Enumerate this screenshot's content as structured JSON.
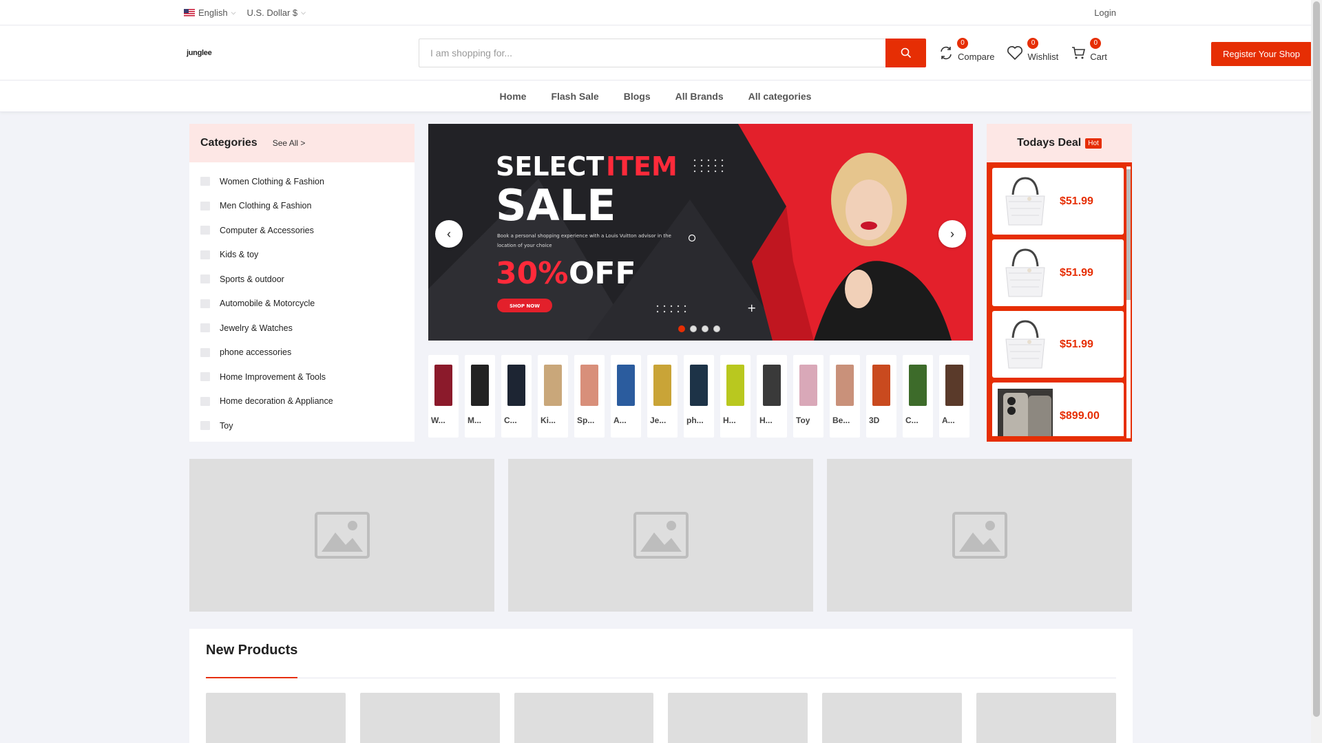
{
  "topbar": {
    "language": "English",
    "currency": "U.S. Dollar $",
    "login": "Login"
  },
  "header": {
    "logo_text": "junglee",
    "search_placeholder": "I am shopping for...",
    "compare": {
      "label": "Compare",
      "count": "0"
    },
    "wishlist": {
      "label": "Wishlist",
      "count": "0"
    },
    "cart": {
      "label": "Cart",
      "count": "0"
    },
    "register": "Register Your Shop"
  },
  "nav": [
    "Home",
    "Flash Sale",
    "Blogs",
    "All Brands",
    "All categories"
  ],
  "categories": {
    "title": "Categories",
    "see_all": "See All >",
    "items": [
      "Women Clothing & Fashion",
      "Men Clothing & Fashion",
      "Computer & Accessories",
      "Kids & toy",
      "Sports & outdoor",
      "Automobile & Motorcycle",
      "Jewelry & Watches",
      "phone accessories",
      "Home Improvement & Tools",
      "Home decoration & Appliance",
      "Toy"
    ]
  },
  "slider": {
    "line1a": "SELECT",
    "line1b": "ITEM",
    "line2": "SALE",
    "desc1": "Book a personal shopping experience with a Louis Vuitton advisor in the",
    "desc2": "location of your choice",
    "discount_a": "30%",
    "discount_b": "OFF",
    "cta": "SHOP NOW",
    "active_dot": 1,
    "dot_count": 4
  },
  "category_strip": [
    {
      "name": "W...",
      "color": "#8b1a2b"
    },
    {
      "name": "M...",
      "color": "#222222"
    },
    {
      "name": "C...",
      "color": "#1d2533"
    },
    {
      "name": "Ki...",
      "color": "#c9a77a"
    },
    {
      "name": "Sp...",
      "color": "#d88f7a"
    },
    {
      "name": "A...",
      "color": "#2b5c9e"
    },
    {
      "name": "Je...",
      "color": "#c9a437"
    },
    {
      "name": "ph...",
      "color": "#1d3347"
    },
    {
      "name": "H...",
      "color": "#b9c81f"
    },
    {
      "name": "H...",
      "color": "#3a3a3a"
    },
    {
      "name": "Toy",
      "color": "#d9a8b8"
    },
    {
      "name": "Be...",
      "color": "#c9917a"
    },
    {
      "name": "3D",
      "color": "#c94a1f"
    },
    {
      "name": "C...",
      "color": "#3d6b2a"
    },
    {
      "name": "A...",
      "color": "#5a3a2a"
    }
  ],
  "todays_deal": {
    "title": "Todays Deal",
    "badge": "Hot",
    "items": [
      {
        "price": "$51.99",
        "img": "handbag"
      },
      {
        "price": "$51.99",
        "img": "handbag"
      },
      {
        "price": "$51.99",
        "img": "handbag"
      },
      {
        "price": "$899.00",
        "img": "phone"
      }
    ]
  },
  "new_products": {
    "title": "New Products"
  },
  "colors": {
    "accent": "#e62e04",
    "soft_header": "#fde7e5",
    "placeholder": "#dedede"
  }
}
